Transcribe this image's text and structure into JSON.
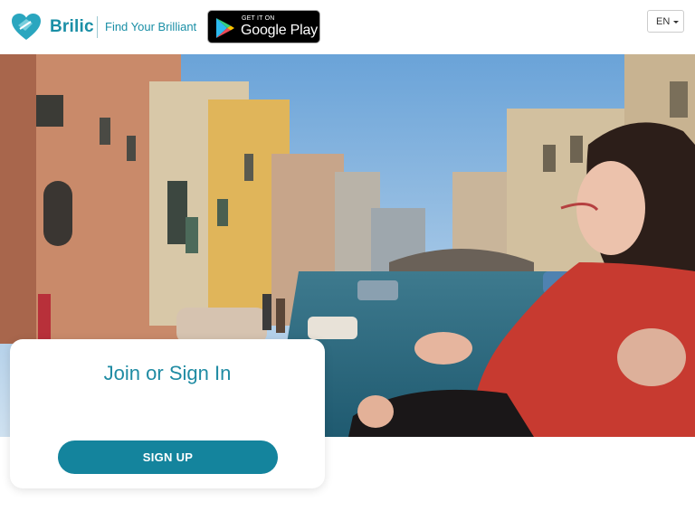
{
  "header": {
    "brand": "Brilic",
    "tagline": "Find Your Brilliant",
    "google_play": {
      "small": "GET IT ON",
      "big": "Google Play"
    },
    "language": "EN"
  },
  "hero": {
    "image": "venice-canal-woman-photo"
  },
  "auth_card": {
    "title": "Join or Sign In",
    "signup_label": "SIGN UP"
  },
  "colors": {
    "brand": "#1a8fa6",
    "button": "#14849d",
    "card_title": "#1f8ba3"
  }
}
